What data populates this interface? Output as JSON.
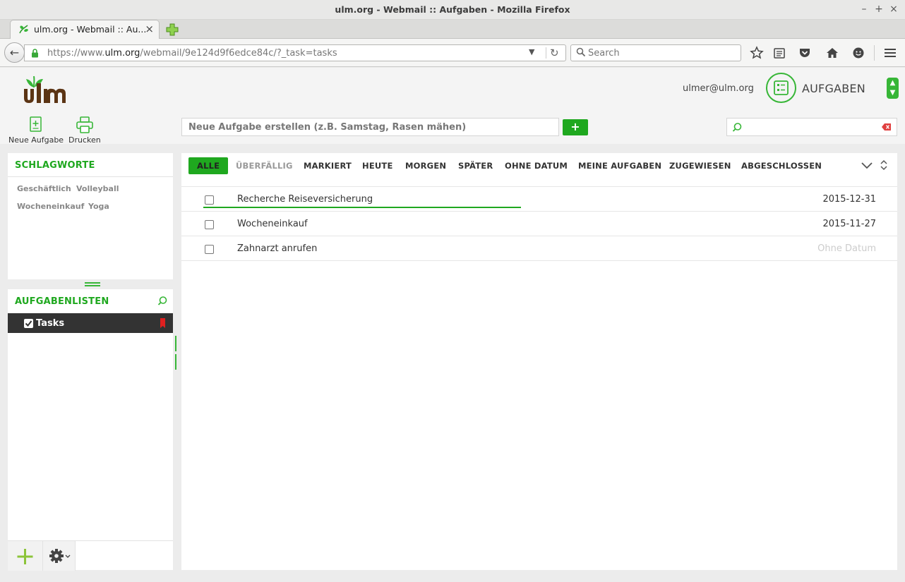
{
  "window": {
    "title": "ulm.org - Webmail :: Aufgaben - Mozilla Firefox",
    "controls": [
      "–",
      "+",
      "×"
    ]
  },
  "tab": {
    "title": "ulm.org - Webmail :: Au...",
    "close": "×"
  },
  "urlbar": {
    "url_prefix": "https://www.",
    "url_host": "ulm.org",
    "url_path": "/webmail/9e124d9f6edce84c/?_task=tasks",
    "search_placeholder": "Search"
  },
  "app": {
    "logo_text": "ulm",
    "user": "ulmer@ulm.org",
    "section_title": "AUFGABEN",
    "brand_color": "#1fa81f"
  },
  "toolbar": {
    "new_task_label": "Neue Aufgabe",
    "print_label": "Drucken",
    "quickadd_placeholder": "Neue Aufgabe erstellen (z.B. Samstag, Rasen mähen)",
    "quickadd_button": "+"
  },
  "sidebar": {
    "tags_header": "SCHLAGWORTE",
    "tags": [
      "Geschäftlich",
      "Volleyball",
      "Wocheneinkauf",
      "Yoga"
    ],
    "lists_header": "AUFGABENLISTEN",
    "lists": [
      {
        "label": "Tasks",
        "checked": true,
        "color": "#e02020"
      }
    ]
  },
  "filters": {
    "items": [
      "ALLE",
      "ÜBERFÄLLIG",
      "MARKIERT",
      "HEUTE",
      "MORGEN",
      "SPÄTER",
      "OHNE DATUM",
      "MEINE AUFGABEN",
      "ZUGEWIESEN",
      "ABGESCHLOSSEN"
    ],
    "active": "ALLE"
  },
  "tasks": [
    {
      "title": "Recherche Reiseversicherung",
      "date": "2015-12-31"
    },
    {
      "title": "Wocheneinkauf",
      "date": "2015-11-27"
    },
    {
      "title": "Zahnarzt anrufen",
      "date": "Ohne Datum"
    }
  ]
}
